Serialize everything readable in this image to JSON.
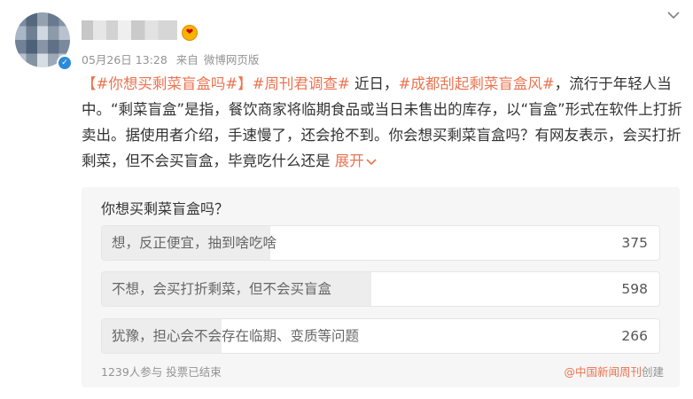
{
  "post": {
    "username": "",
    "time": "05月26日 13:28",
    "source_prefix": "来自",
    "source": "微博网页版",
    "content": {
      "bracket_open": "【",
      "tag1": "#你想买剩菜盲盒吗#",
      "bracket_close": "】",
      "tag2": "#周刊君调查#",
      "text1": " 近日，",
      "tag3": "#成都刮起剩菜盲盒风#",
      "text2": "，流行于年轻人当中。“剩菜盲盒”是指，餐饮商家将临期食品或当日未售出的库存，以“盲盒”形式在软件上打折卖出。据使用者介绍，手速慢了，还会抢不到。你会想买剩菜盲盒吗？有网友表示，会买打折剩菜，但不会买盲盒，毕竟吃什么还是 ",
      "expand_label": "展开"
    }
  },
  "poll": {
    "question": "你想买剩菜盲盒吗？",
    "options": [
      {
        "label": "想，反正便宜，抽到啥吃啥",
        "count": "375",
        "share": 0.3026
      },
      {
        "label": "不想，会买打折剩菜，但不会买盲盒",
        "count": "598",
        "share": 0.4826
      },
      {
        "label": "犹豫，担心会不会存在临期、变质等问题",
        "count": "266",
        "share": 0.2147
      }
    ],
    "footer": "1239人参与 投票已结束",
    "creator_prefix": "@",
    "creator_name": "中国新闻周刊",
    "creator_suffix": "创建"
  },
  "colors": {
    "accent": "#eb7350",
    "verified": "#2d8ad8",
    "option_fill": "#ededed"
  },
  "icons": {
    "more": "chevron-down-icon",
    "verified": "verified-badge-icon",
    "vip": "vip-badge-icon"
  }
}
